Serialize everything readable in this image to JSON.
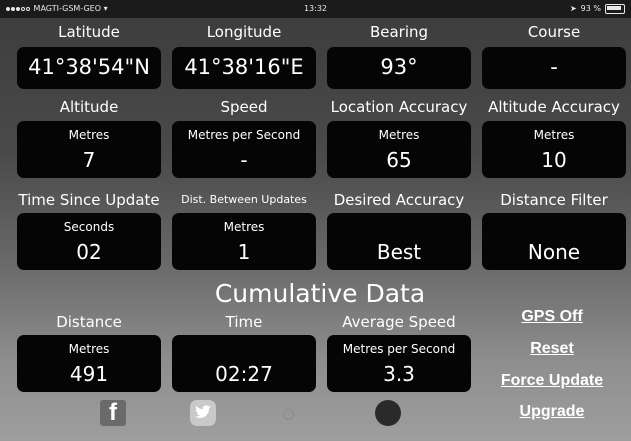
{
  "status": {
    "carrier": "MAGTI-GSM-GEO",
    "time": "13:32",
    "battery": "93 %"
  },
  "row1": [
    {
      "label": "Latitude",
      "value": "41°38'54\"N"
    },
    {
      "label": "Longitude",
      "value": "41°38'16\"E"
    },
    {
      "label": "Bearing",
      "value": "93°"
    },
    {
      "label": "Course",
      "value": "-"
    }
  ],
  "row2": [
    {
      "label": "Altitude",
      "unit": "Metres",
      "value": "7"
    },
    {
      "label": "Speed",
      "unit": "Metres per Second",
      "value": "-"
    },
    {
      "label": "Location Accuracy",
      "unit": "Metres",
      "value": "65"
    },
    {
      "label": "Altitude Accuracy",
      "unit": "Metres",
      "value": "10"
    }
  ],
  "row3": [
    {
      "label": "Time Since Update",
      "unit": "Seconds",
      "value": "02"
    },
    {
      "label": "Dist. Between Updates",
      "unit": "Metres",
      "value": "1"
    },
    {
      "label": "Desired Accuracy",
      "unit": "",
      "value": "Best"
    },
    {
      "label": "Distance Filter",
      "unit": "",
      "value": "None"
    }
  ],
  "cumulative": {
    "title": "Cumulative Data",
    "items": [
      {
        "label": "Distance",
        "unit": "Metres",
        "value": "491"
      },
      {
        "label": "Time",
        "unit": "",
        "value": "02:27"
      },
      {
        "label": "Average Speed",
        "unit": "Metres per Second",
        "value": "3.3"
      }
    ]
  },
  "actions": {
    "gps_off": "GPS Off",
    "reset": "Reset",
    "force_update": "Force Update",
    "upgrade": "Upgrade"
  },
  "icons": {
    "facebook": "facebook-icon",
    "twitter": "twitter-icon",
    "info": "info-icon",
    "record": "record-dot-icon"
  },
  "colors": {
    "box": "#050505",
    "text": "#ffffff"
  }
}
